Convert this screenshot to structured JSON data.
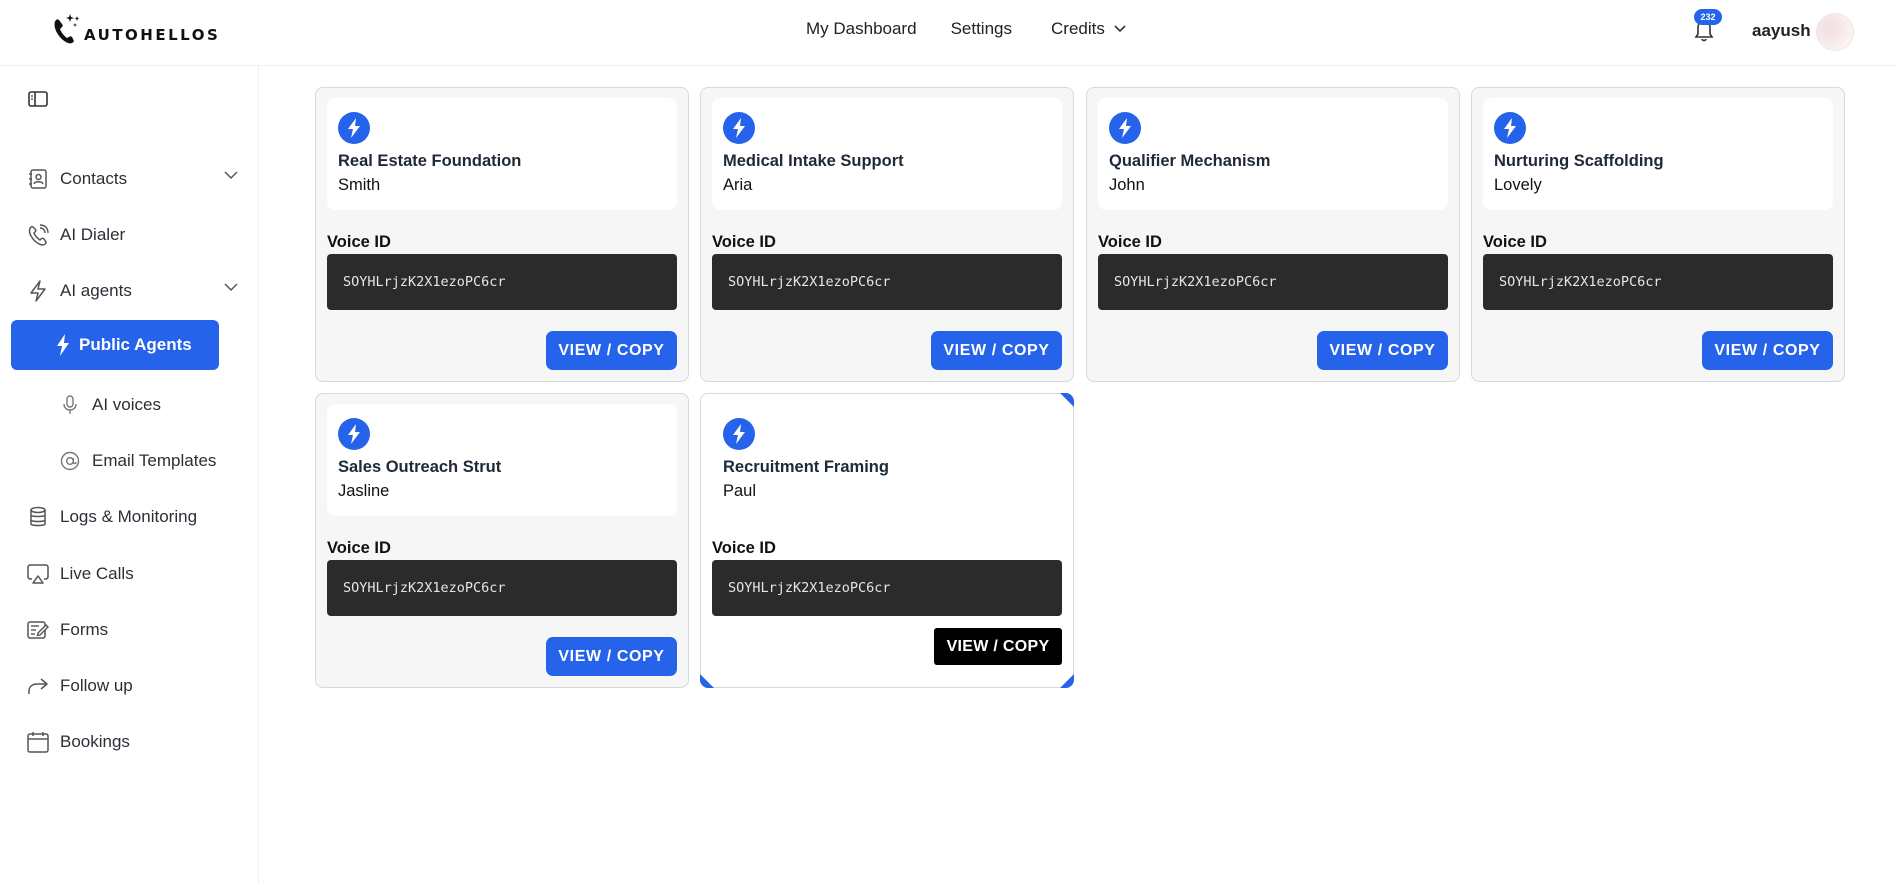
{
  "header": {
    "logo_text": "AUTOHELLOS",
    "nav": {
      "dashboard": "My Dashboard",
      "settings": "Settings",
      "credits": "Credits"
    },
    "notification_count": "232",
    "username": "aayush"
  },
  "sidebar": {
    "items": [
      {
        "label": "Contacts"
      },
      {
        "label": "AI Dialer"
      },
      {
        "label": "AI agents"
      },
      {
        "label": "Public Agents"
      },
      {
        "label": "AI voices"
      },
      {
        "label": "Email Templates"
      },
      {
        "label": "Logs & Monitoring"
      },
      {
        "label": "Live Calls"
      },
      {
        "label": "Forms"
      },
      {
        "label": "Follow up"
      },
      {
        "label": "Bookings"
      }
    ]
  },
  "agents": [
    {
      "title": "Real Estate Foundation",
      "voice_name": "Smith",
      "voice_id_label": "Voice ID",
      "voice_id": "SOYHLrjzK2X1ezoPC6cr",
      "button": "VIEW / COPY"
    },
    {
      "title": "Medical Intake Support",
      "voice_name": "Aria",
      "voice_id_label": "Voice ID",
      "voice_id": "SOYHLrjzK2X1ezoPC6cr",
      "button": "VIEW / COPY"
    },
    {
      "title": "Qualifier Mechanism",
      "voice_name": "John",
      "voice_id_label": "Voice ID",
      "voice_id": "SOYHLrjzK2X1ezoPC6cr",
      "button": "VIEW / COPY"
    },
    {
      "title": "Nurturing Scaffolding",
      "voice_name": "Lovely",
      "voice_id_label": "Voice ID",
      "voice_id": "SOYHLrjzK2X1ezoPC6cr",
      "button": "VIEW / COPY"
    },
    {
      "title": "Sales Outreach Strut",
      "voice_name": "Jasline",
      "voice_id_label": "Voice ID",
      "voice_id": "SOYHLrjzK2X1ezoPC6cr",
      "button": "VIEW / COPY"
    },
    {
      "title": "Recruitment Framing",
      "voice_name": "Paul",
      "voice_id_label": "Voice ID",
      "voice_id": "SOYHLrjzK2X1ezoPC6cr",
      "button": "VIEW / COPY"
    }
  ],
  "colors": {
    "accent": "#2563eb",
    "voice_box": "#2b2b2b",
    "hover_button": "#000000"
  }
}
